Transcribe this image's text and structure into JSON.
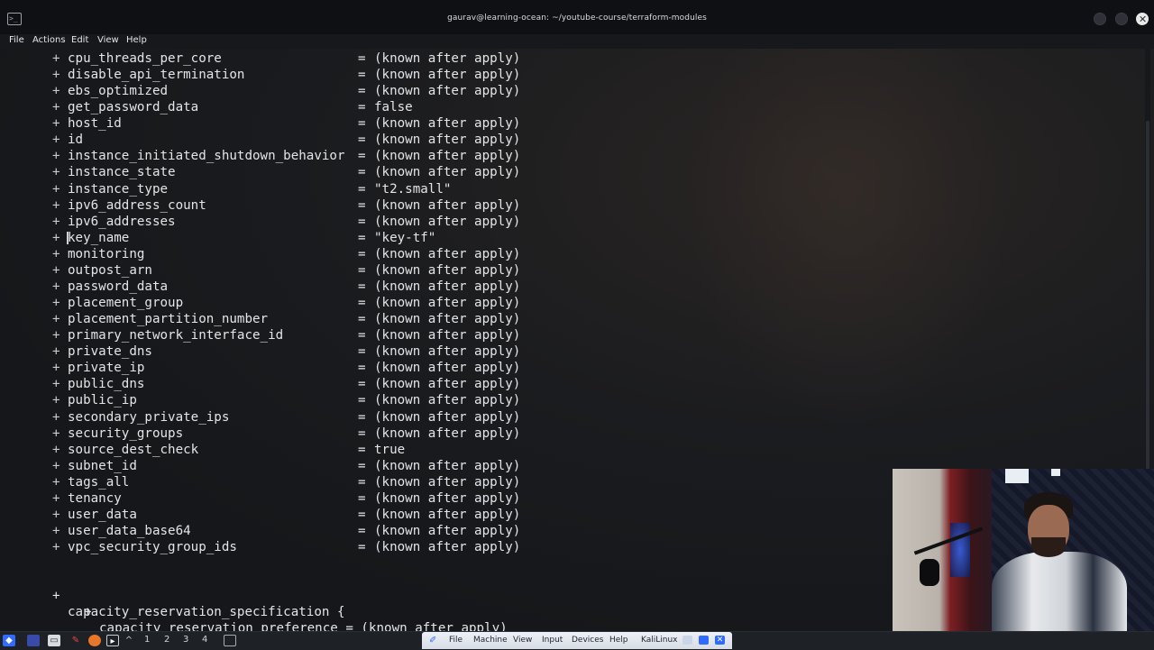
{
  "window": {
    "title": "gaurav@learning-ocean: ~/youtube-course/terraform-modules",
    "app_icon_glyph": ">_"
  },
  "menu": [
    "File",
    "Actions",
    "Edit",
    "Help"
  ],
  "menu_help": "View",
  "terminal": {
    "attributes": [
      {
        "key": "cpu_threads_per_core",
        "value": "(known after apply)"
      },
      {
        "key": "disable_api_termination",
        "value": "(known after apply)"
      },
      {
        "key": "ebs_optimized",
        "value": "(known after apply)"
      },
      {
        "key": "get_password_data",
        "value": "false"
      },
      {
        "key": "host_id",
        "value": "(known after apply)"
      },
      {
        "key": "id",
        "value": "(known after apply)"
      },
      {
        "key": "instance_initiated_shutdown_behavior",
        "value": "(known after apply)"
      },
      {
        "key": "instance_state",
        "value": "(known after apply)"
      },
      {
        "key": "instance_type",
        "value": "\"t2.small\""
      },
      {
        "key": "ipv6_address_count",
        "value": "(known after apply)"
      },
      {
        "key": "ipv6_addresses",
        "value": "(known after apply)"
      },
      {
        "key": "key_name",
        "value": "\"key-tf\""
      },
      {
        "key": "monitoring",
        "value": "(known after apply)"
      },
      {
        "key": "outpost_arn",
        "value": "(known after apply)"
      },
      {
        "key": "password_data",
        "value": "(known after apply)"
      },
      {
        "key": "placement_group",
        "value": "(known after apply)"
      },
      {
        "key": "placement_partition_number",
        "value": "(known after apply)"
      },
      {
        "key": "primary_network_interface_id",
        "value": "(known after apply)"
      },
      {
        "key": "private_dns",
        "value": "(known after apply)"
      },
      {
        "key": "private_ip",
        "value": "(known after apply)"
      },
      {
        "key": "public_dns",
        "value": "(known after apply)"
      },
      {
        "key": "public_ip",
        "value": "(known after apply)"
      },
      {
        "key": "secondary_private_ips",
        "value": "(known after apply)"
      },
      {
        "key": "security_groups",
        "value": "(known after apply)"
      },
      {
        "key": "source_dest_check",
        "value": "true"
      },
      {
        "key": "subnet_id",
        "value": "(known after apply)"
      },
      {
        "key": "tags_all",
        "value": "(known after apply)"
      },
      {
        "key": "tenancy",
        "value": "(known after apply)"
      },
      {
        "key": "user_data",
        "value": "(known after apply)"
      },
      {
        "key": "user_data_base64",
        "value": "(known after apply)"
      },
      {
        "key": "vpc_security_group_ids",
        "value": "(known after apply)"
      }
    ],
    "plus": "+",
    "equals": "=",
    "block": {
      "header": "capacity_reservation_specification {",
      "nested": "capacity_reservation_preference = (known after apply)"
    }
  },
  "taskbar": {
    "workspaces": [
      "1",
      "2",
      "3",
      "4"
    ]
  },
  "vbox_menu": [
    "File",
    "Machine",
    "View",
    "Input",
    "Devices",
    "Help",
    "KaliLinux"
  ],
  "colors": {
    "terminal_text": "#e3e5e8",
    "terminal_bg": "#16181c",
    "taskbar_bg": "#1e2126",
    "accent_blue": "#2f6bff"
  }
}
